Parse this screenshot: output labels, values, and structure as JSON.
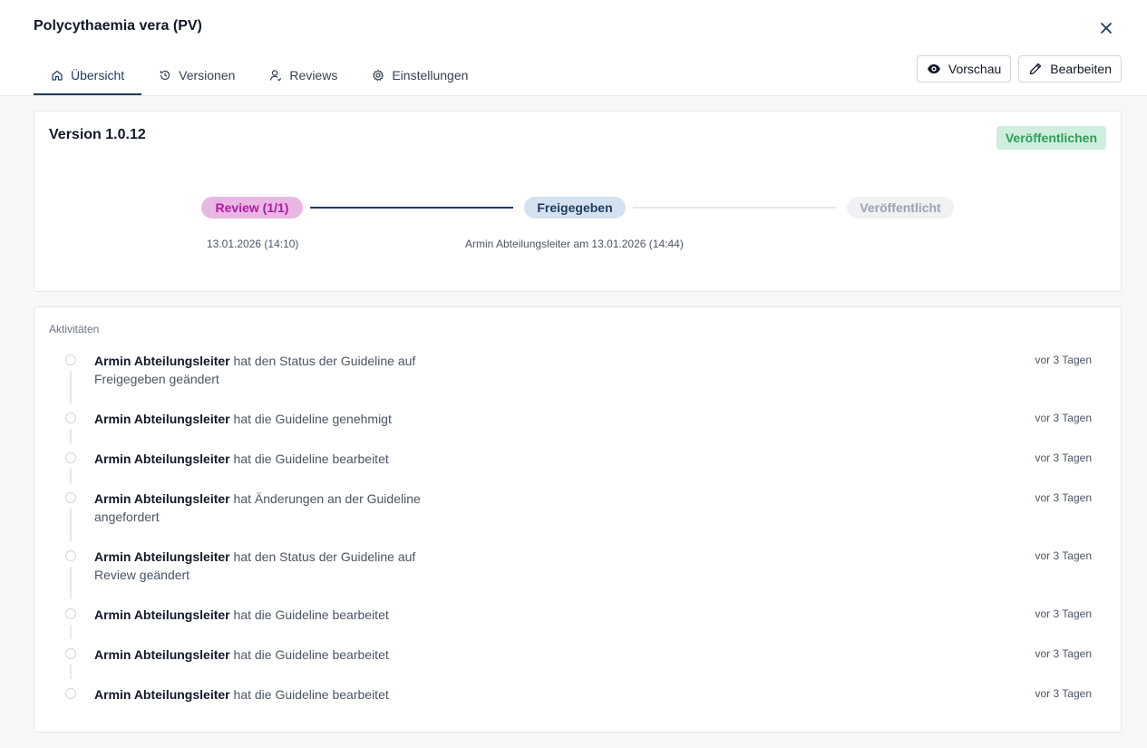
{
  "header": {
    "title": "Polycythaemia vera (PV)",
    "tabs": [
      {
        "label": "Übersicht",
        "icon": "home-icon",
        "active": true
      },
      {
        "label": "Versionen",
        "icon": "history-icon",
        "active": false
      },
      {
        "label": "Reviews",
        "icon": "user-icon",
        "active": false
      },
      {
        "label": "Einstellungen",
        "icon": "gear-icon",
        "active": false
      }
    ],
    "preview_label": "Vorschau",
    "edit_label": "Bearbeiten"
  },
  "version": {
    "title": "Version 1.0.12",
    "publish_label": "Veröffentlichen",
    "steps": [
      {
        "label": "Review (1/1)",
        "date": "13.01.2026 (14:10)"
      },
      {
        "label": "Freigegeben",
        "date": "Armin Abteilungsleiter am 13.01.2026 (14:44)"
      },
      {
        "label": "Veröffentlicht",
        "date": ""
      }
    ]
  },
  "activities": {
    "label": "Aktivitäten",
    "items": [
      {
        "who": "Armin Abteilungsleiter",
        "text": " hat den Status der Guideline auf Freigegeben geändert",
        "time": "vor 3 Tagen"
      },
      {
        "who": "Armin Abteilungsleiter",
        "text": " hat die Guideline genehmigt",
        "time": "vor 3 Tagen"
      },
      {
        "who": "Armin Abteilungsleiter",
        "text": " hat die Guideline bearbeitet",
        "time": "vor 3 Tagen"
      },
      {
        "who": "Armin Abteilungsleiter",
        "text": " hat Änderungen an der Guideline angefordert",
        "time": "vor 3 Tagen"
      },
      {
        "who": "Armin Abteilungsleiter",
        "text": " hat den Status der Guideline auf Review geändert",
        "time": "vor 3 Tagen"
      },
      {
        "who": "Armin Abteilungsleiter",
        "text": " hat die Guideline bearbeitet",
        "time": "vor 3 Tagen"
      },
      {
        "who": "Armin Abteilungsleiter",
        "text": " hat die Guideline bearbeitet",
        "time": "vor 3 Tagen"
      },
      {
        "who": "Armin Abteilungsleiter",
        "text": " hat die Guideline bearbeitet",
        "time": "vor 3 Tagen"
      }
    ]
  },
  "colors": {
    "accent": "#1e3a5f",
    "publish_green": "#2f9d5a",
    "review_pink": "#b21a9e"
  }
}
